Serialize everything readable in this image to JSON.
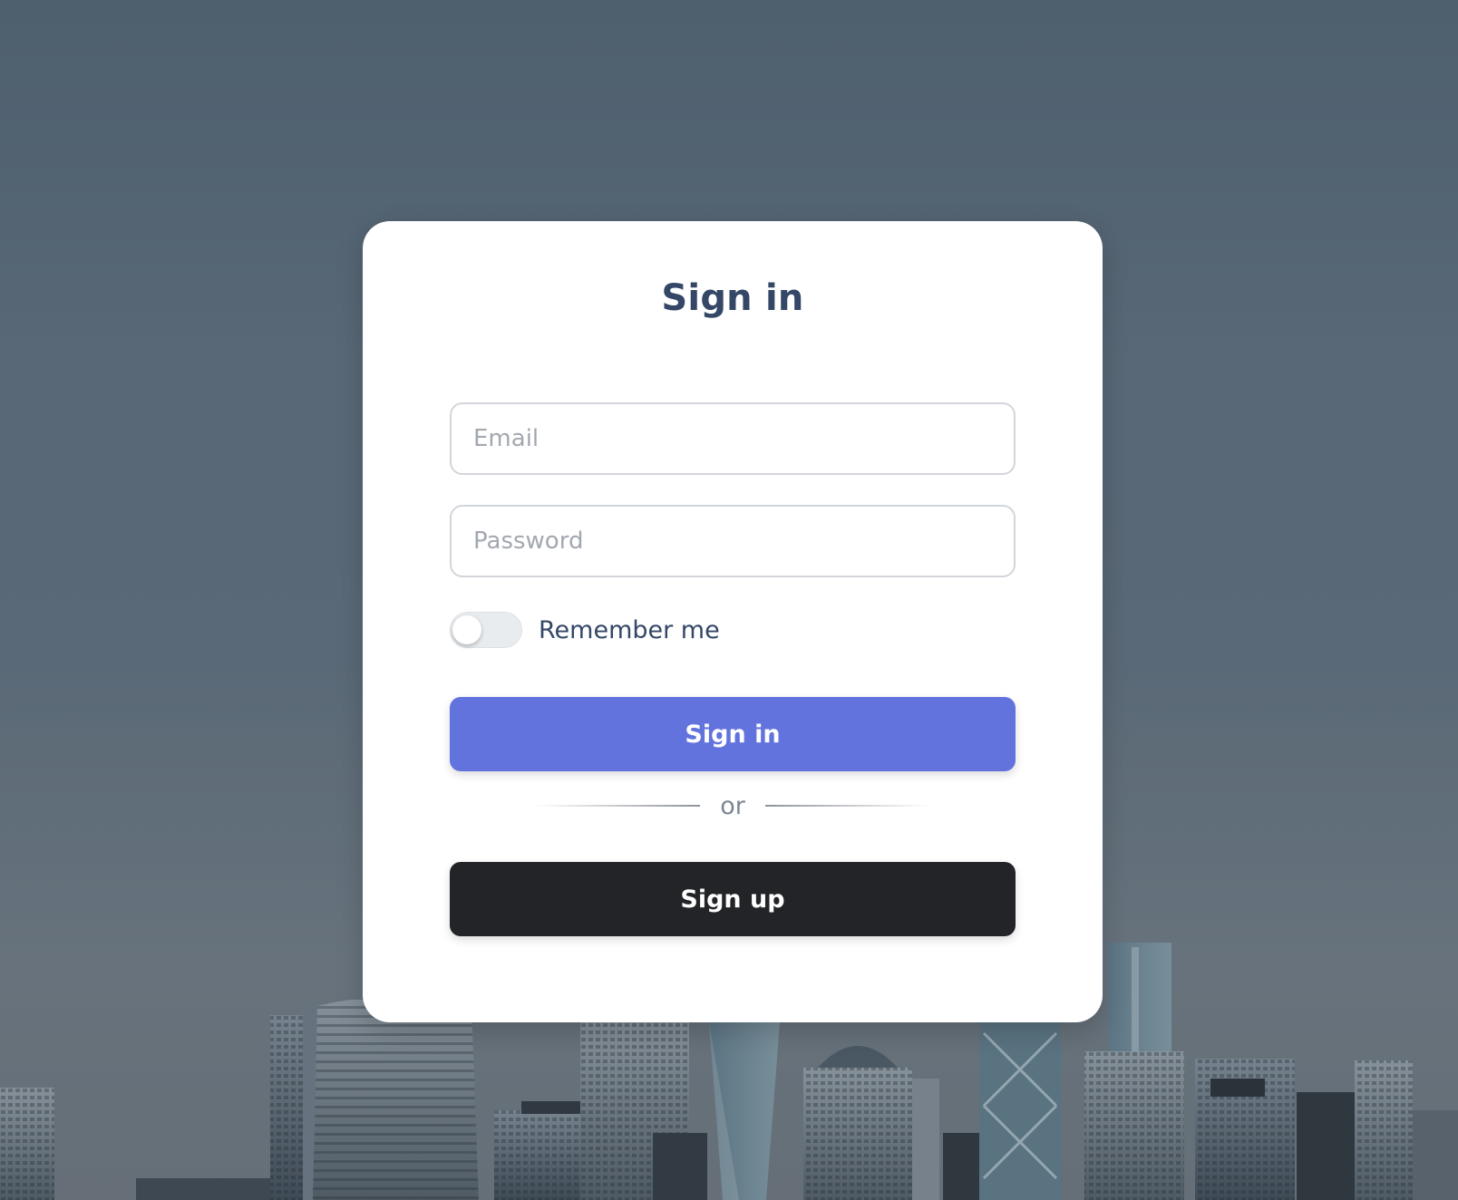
{
  "signin_card": {
    "title": "Sign in",
    "email": {
      "placeholder": "Email",
      "value": ""
    },
    "password": {
      "placeholder": "Password",
      "value": ""
    },
    "remember": {
      "label": "Remember me",
      "checked": false
    },
    "signin_button_label": "Sign in",
    "divider_text": "or",
    "signup_button_label": "Sign up"
  },
  "colors": {
    "primary": "#6273de",
    "dark_button": "#232428",
    "title_text": "#344767",
    "background_sky": "#56687a"
  }
}
